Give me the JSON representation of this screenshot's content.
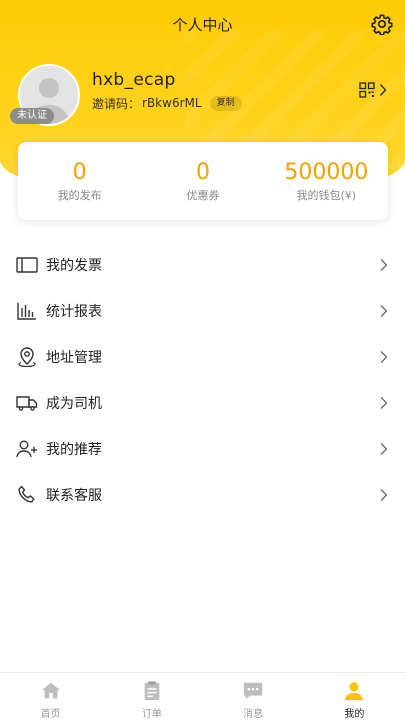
{
  "header": {
    "title": "个人中心",
    "icons": {
      "settings": "gear-icon",
      "qr": "qr-code-icon"
    }
  },
  "profile": {
    "username": "hxb_ecap",
    "verify_badge": "未认证",
    "invite_label": "邀请码：",
    "invite_code": "rBkw6rML",
    "copy_label": "复制"
  },
  "stats": [
    {
      "value": "0",
      "label": "我的发布"
    },
    {
      "value": "0",
      "label": "优惠券"
    },
    {
      "value": "500000",
      "label": "我的钱包(¥)"
    }
  ],
  "menu": [
    {
      "label": "我的发票",
      "icon": "invoice-icon"
    },
    {
      "label": "统计报表",
      "icon": "bar-chart-icon"
    },
    {
      "label": "地址管理",
      "icon": "location-pin-icon"
    },
    {
      "label": "成为司机",
      "icon": "truck-icon"
    },
    {
      "label": "我的推荐",
      "icon": "add-user-icon"
    },
    {
      "label": "联系客服",
      "icon": "phone-icon"
    }
  ],
  "tabbar": [
    {
      "label": "首页",
      "icon": "home-icon",
      "active": false
    },
    {
      "label": "订单",
      "icon": "clipboard-icon",
      "active": false
    },
    {
      "label": "消息",
      "icon": "chat-icon",
      "active": false
    },
    {
      "label": "我的",
      "icon": "user-icon",
      "active": true
    }
  ],
  "colors": {
    "accent": "#ffcb05",
    "stat_value": "#f0a300",
    "active_tab": "#ffc107",
    "inactive_tab": "#bdbdbd"
  }
}
